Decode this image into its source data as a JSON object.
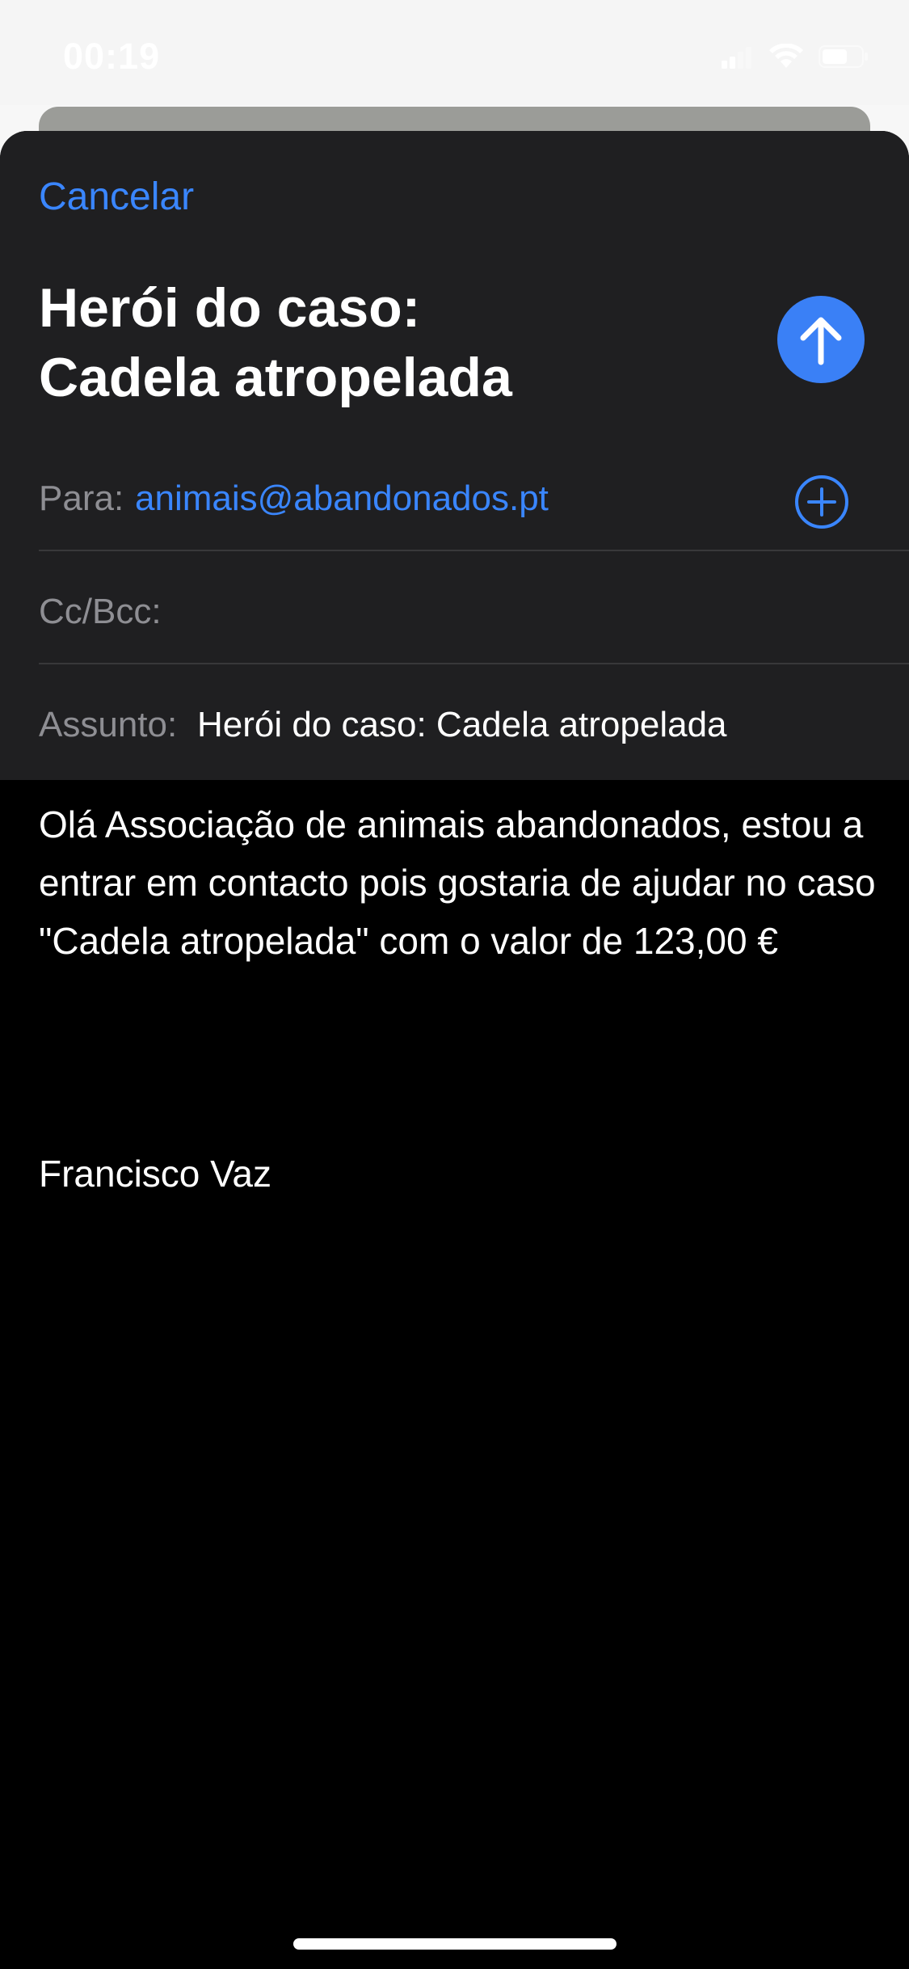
{
  "status_bar": {
    "time": "00:19",
    "icons": [
      "signal-icon",
      "wifi-icon",
      "battery-icon"
    ]
  },
  "compose": {
    "cancel_label": "Cancelar",
    "title": "Herói do caso:\nCadela atropelada",
    "send_icon": "arrow-up-icon",
    "to": {
      "label": "Para:",
      "value": "animais@abandonados.pt",
      "add_icon": "plus-circle-icon"
    },
    "cc": {
      "label": "Cc/Bcc:",
      "value": ""
    },
    "subject": {
      "label": "Assunto:",
      "value": "Herói do caso: Cadela atropelada"
    },
    "body": "Olá Associação de animais abandonados, estou a entrar em contacto pois gostaria de ajudar no caso \"Cadela atropelada\" com o valor de 123,00 €",
    "signature": "Francisco Vaz"
  },
  "colors": {
    "accent": "#3a86ff",
    "header_bg": "#1f1f21",
    "body_bg": "#000000"
  }
}
